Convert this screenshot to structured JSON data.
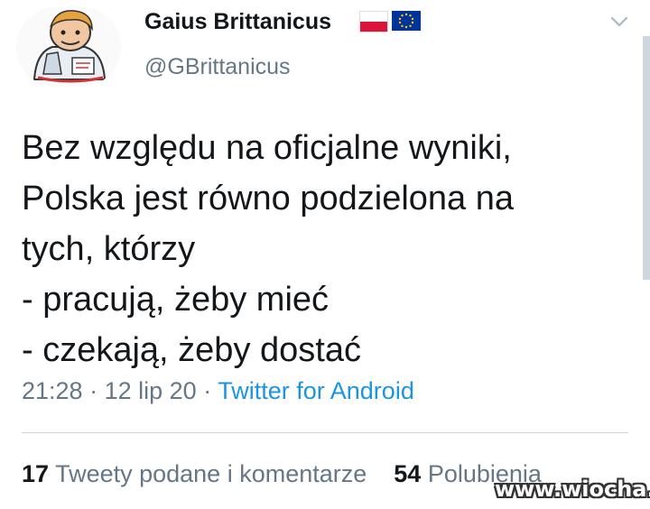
{
  "profile": {
    "display_name": "Gaius Brittanicus",
    "handle": "@GBrittanicus",
    "flags": [
      "poland-flag",
      "eu-flag"
    ]
  },
  "tweet": {
    "lines": [
      "Bez względu na oficjalne wyniki,",
      "Polska jest równo podzielona na",
      "tych, którzy",
      "- pracują, żeby mieć",
      "- czekają, żeby dostać"
    ]
  },
  "meta": {
    "time": "21:28",
    "date": "12 lip 20",
    "separator": "·",
    "source": "Twitter for Android"
  },
  "stats": {
    "retweets_count": "17",
    "retweets_label": "Tweety podane i komentarze",
    "likes_count": "54",
    "likes_label": "Polubienia"
  },
  "watermark": "www.wiocha.pl",
  "colors": {
    "text": "#14171a",
    "muted": "#657786",
    "link": "#1b95e0",
    "flag_red": "#dc143c",
    "eu_blue": "#003399",
    "eu_star": "#ffcc00"
  }
}
